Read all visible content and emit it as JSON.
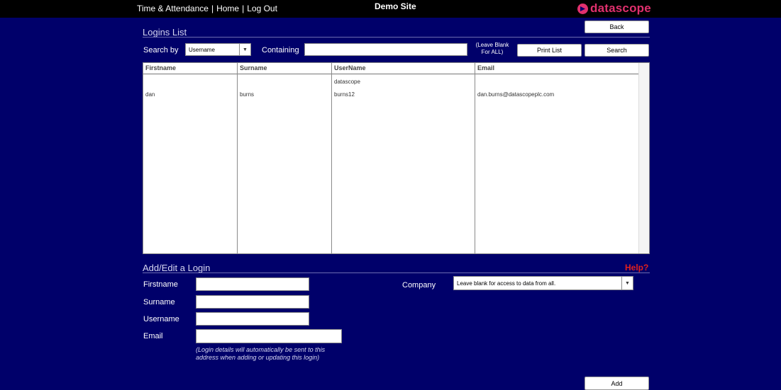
{
  "nav": {
    "time_attendance": "Time & Attendance",
    "home": "Home",
    "logout": "Log Out",
    "sep": "|"
  },
  "site": {
    "name": "Demo Site"
  },
  "logo": {
    "text": "datascope",
    "icon": "datascope-logo-icon",
    "color": "#e0306e"
  },
  "colors": {
    "background": "#00006a",
    "topbar": "#000000",
    "help": "#e0201e"
  },
  "logins": {
    "section_title": "Logins List",
    "back_label": "Back",
    "search_by_label": "Search by",
    "search_by_value": "Username",
    "containing_label": "Containing",
    "containing_value": "",
    "leave_blank_line1": "(Leave Blank",
    "leave_blank_line2": "For ALL)",
    "print_label": "Print List",
    "search_label": "Search",
    "columns": [
      "Firstname",
      "Surname",
      "UserName",
      "Email"
    ],
    "rows": [
      {
        "firstname": "",
        "surname": "",
        "username": "datascope",
        "email": ""
      },
      {
        "firstname": "dan",
        "surname": "burns",
        "username": "burns12",
        "email": "dan.burns@datascopeplc.com"
      }
    ]
  },
  "edit": {
    "section_title": "Add/Edit a Login",
    "help_label": "Help?",
    "firstname_label": "Firstname",
    "surname_label": "Surname",
    "username_label": "Username",
    "email_label": "Email",
    "company_label": "Company",
    "company_value": "Leave blank for access to data from all.",
    "email_note_line1": "(Login details will automatically be sent to this",
    "email_note_line2": "address when adding or updating this login)",
    "add_label": "Add"
  }
}
